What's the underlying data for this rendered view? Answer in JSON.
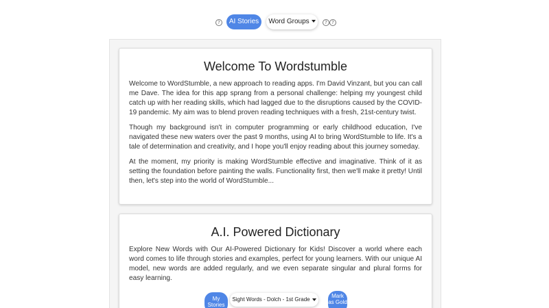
{
  "topbar": {
    "help_icon_glyph": "?",
    "ai_stories_label": "AI Stories",
    "word_groups_label": "Word Groups",
    "help_icons_right": [
      "?",
      "?"
    ]
  },
  "welcome_card": {
    "title": "Welcome To Wordstumble",
    "paragraphs": [
      "Welcome to WordStumble, a new approach to reading apps. I'm David Vinzant, but you can call me Dave. The idea for this app sprang from a personal challenge: helping my youngest child catch up with her reading skills, which had lagged due to the disruptions caused by the COVID-19 pandemic. My aim was to blend proven reading techniques with a fresh, 21st-century twist.",
      "Though my background isn't in computer programming or early childhood education, I've navigated these new waters over the past 9 months, using AI to bring WordStumble to life. It's a tale of determination and creativity, and I hope you'll enjoy reading about this journey someday.",
      "At the moment, my priority is making WordStumble effective and imaginative. Think of it as setting the foundation before painting the walls. Functionality first, then we'll make it pretty! Until then, let's step into the world of WordStumble..."
    ]
  },
  "dictionary_card": {
    "title": "A.I. Powered Dictionary",
    "paragraph": "Explore New Words with Our AI-Powered Dictionary for Kids! Discover a world where each word comes to life through stories and examples, perfect for young learners. With our unique AI model, new words are added regularly, and we even separate singular and plural forms for easy learning."
  },
  "bottom_bar": {
    "my_stories_label": "My Stories",
    "sight_words_label": "Sight Words - Dolch - 1st Grade",
    "mark_as_gold_label": "Mark as Gold"
  },
  "colors": {
    "accent_blue": "#4f86e6"
  }
}
